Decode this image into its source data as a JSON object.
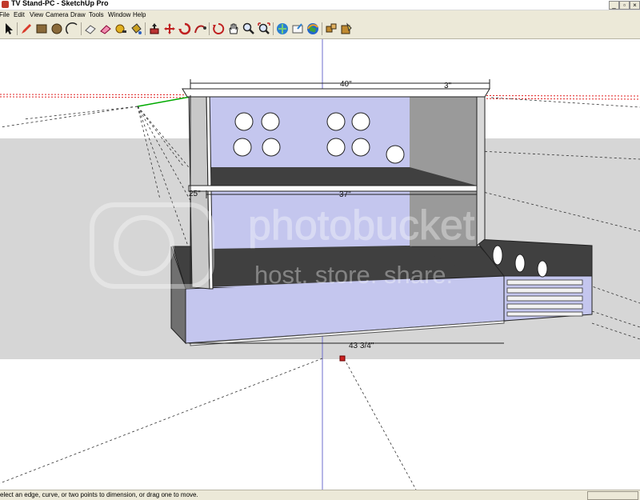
{
  "window": {
    "title": "TV Stand-PC - SketchUp Pro"
  },
  "menu": [
    "File",
    "Edit",
    "View",
    "Camera",
    "Draw",
    "Tools",
    "Window",
    "Help"
  ],
  "toolbar": {
    "tools": [
      "select",
      "pencil",
      "rectangle",
      "circle",
      "arc",
      "eraser-shape",
      "eraser",
      "tape-measure",
      "paint-bucket",
      "push-pull",
      "move",
      "rotate",
      "follow-me",
      "orbit",
      "pan",
      "zoom",
      "zoom-extents",
      "get-models",
      "share-model",
      "google-earth",
      "components",
      "materials"
    ]
  },
  "dimensions": {
    "top_width": "40\"",
    "top_right": "3\"",
    "height": "25\"",
    "shelf_width": "37\"",
    "base_width": "43 3/4\""
  },
  "watermark": {
    "brand": "photobucket",
    "tagline": "host. store. share."
  },
  "status": {
    "text": "elect an edge, curve, or two points to dimension, or drag one to move."
  },
  "colors": {
    "face_light": "#c4c6ee",
    "face_dark": "#404040",
    "face_mid": "#9a9a9a",
    "axis_red": "#cc0000",
    "axis_green": "#00aa00",
    "axis_blue": "#3333aa"
  }
}
